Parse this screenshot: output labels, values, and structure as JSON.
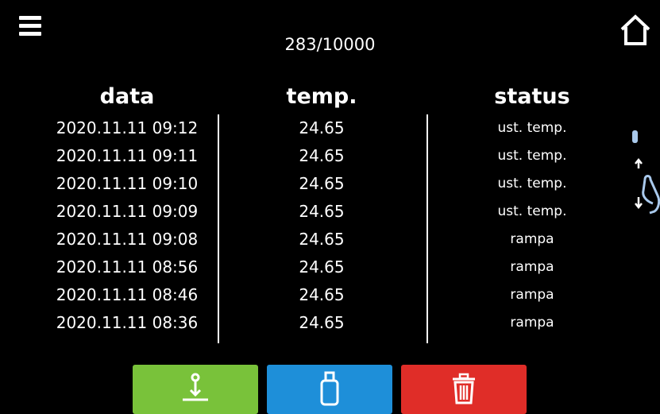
{
  "header": {
    "counter": "283/10000"
  },
  "table": {
    "columns": [
      "data",
      "temp.",
      "status"
    ],
    "rows": [
      {
        "date": "2020.11.11 09:12",
        "temp": "24.65",
        "status": "ust. temp."
      },
      {
        "date": "2020.11.11 09:11",
        "temp": "24.65",
        "status": "ust. temp."
      },
      {
        "date": "2020.11.11 09:10",
        "temp": "24.65",
        "status": "ust. temp."
      },
      {
        "date": "2020.11.11 09:09",
        "temp": "24.65",
        "status": "ust. temp."
      },
      {
        "date": "2020.11.11 09:08",
        "temp": "24.65",
        "status": "rampa"
      },
      {
        "date": "2020.11.11 08:56",
        "temp": "24.65",
        "status": "rampa"
      },
      {
        "date": "2020.11.11 08:46",
        "temp": "24.65",
        "status": "rampa"
      },
      {
        "date": "2020.11.11 08:36",
        "temp": "24.65",
        "status": "rampa"
      }
    ]
  },
  "toolbar": {
    "export_icon": "download-to-device-icon",
    "usb_icon": "usb-drive-icon",
    "delete_icon": "trash-icon"
  },
  "icons": {
    "menu": "hamburger-menu-icon",
    "home": "home-icon",
    "swipe": "swipe-scroll-hand-icon"
  },
  "colors": {
    "background": "#000000",
    "export_button": "#79c23a",
    "usb_button": "#1e8fd9",
    "delete_button": "#e02d28",
    "scroll_indicator": "#a9c9ec"
  }
}
